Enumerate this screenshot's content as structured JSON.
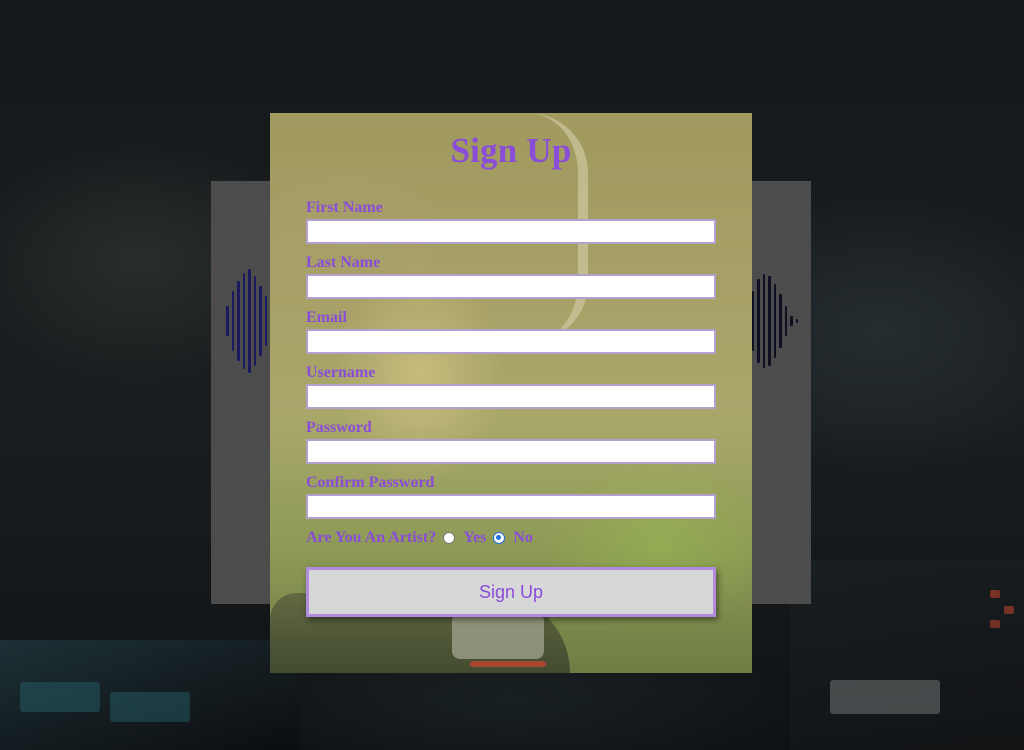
{
  "form": {
    "title": "Sign Up",
    "fields": [
      {
        "label": "First Name",
        "value": ""
      },
      {
        "label": "Last Name",
        "value": ""
      },
      {
        "label": "Email",
        "value": ""
      },
      {
        "label": "Username",
        "value": ""
      },
      {
        "label": "Password",
        "value": ""
      },
      {
        "label": "Confirm Password",
        "value": ""
      }
    ],
    "artist_question": "Are You An Artist?",
    "artist_options": [
      {
        "label": "Yes",
        "checked": false
      },
      {
        "label": "No",
        "checked": true
      }
    ],
    "submit_label": "Sign Up"
  },
  "colors": {
    "accent": "#8a4dd8",
    "input_border": "#b3a0cf",
    "button_bg": "#d7d6d8",
    "button_border": "#b18bde",
    "back_card": "#4c4c4c",
    "waveform": "#1c1a5e",
    "radio_checked": "#1f6fe0"
  }
}
